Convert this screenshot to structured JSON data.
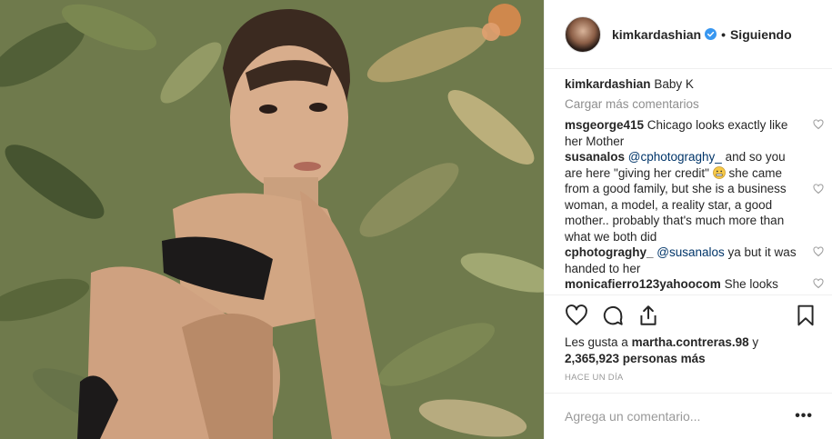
{
  "header": {
    "username": "kimkardashian",
    "separator": "•",
    "follow_status": "Siguiendo"
  },
  "caption": {
    "username": "kimkardashian",
    "text": "Baby K"
  },
  "load_more": "Cargar más comentarios",
  "comments": [
    {
      "username": "msgeorge415",
      "text_before": " Chicago looks exactly like her Mother",
      "mention": "",
      "text_after": ""
    },
    {
      "username": "susanalos",
      "text_before": " ",
      "mention": "@cphotograghy_",
      "text_after": " and so you are here \"giving her credit\"",
      "text_tail": " she came from a good family, but she is a business woman, a model, a reality star, a good mother.. probably that's much more than what we both did"
    },
    {
      "username": "cphotograghy_",
      "text_before": " ",
      "mention": "@susanalos",
      "text_after": " ya but it was handed to her"
    },
    {
      "username": "monicafierro123yahoocom",
      "text_before": " She looks"
    }
  ],
  "likes": {
    "prefix": "Les gusta a ",
    "liker": "martha.contreras.98",
    "middle": " y",
    "count": "2,365,923 personas más"
  },
  "timestamp": "HACE UN DÍA",
  "add_comment": {
    "placeholder": "Agrega un comentario...",
    "more_label": "•••"
  },
  "icons": {
    "verified": "verified-badge-icon",
    "like": "heart-icon",
    "comment": "comment-bubble-icon",
    "share": "share-icon",
    "save": "bookmark-icon"
  },
  "colors": {
    "verified": "#3897f0",
    "mention": "#003569",
    "muted": "#8e8e8e"
  }
}
